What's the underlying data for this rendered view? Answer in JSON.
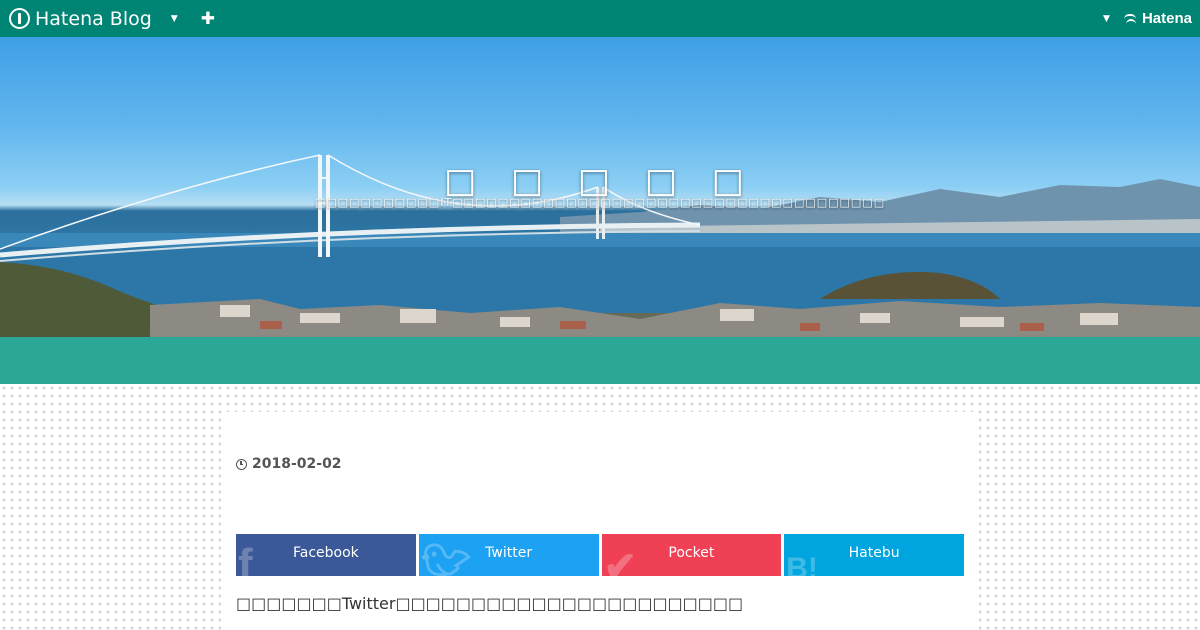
{
  "topbar": {
    "logo_text": "Hatena Blog",
    "brand_text": "Hatena",
    "bg_color": "#008574"
  },
  "hero": {
    "blog_title": "□ □ □ □ □",
    "blog_description": "□□□□□□□□□□□IT□□□□□□□□□□□□□□□□□□□□□□□□□□□□□□□□□□□□□□"
  },
  "band": {
    "color": "#2aa797"
  },
  "article": {
    "date": "2018-02-02",
    "lead_text": "□□□□□□□Twitter□□□□□□□□□□□□□□□□□□□□□□□"
  },
  "share": {
    "facebook_label": "Facebook",
    "twitter_label": "Twitter",
    "pocket_label": "Pocket",
    "hatebu_label": "Hatebu",
    "colors": {
      "facebook": "#3b5998",
      "twitter": "#1da1f2",
      "pocket": "#ef4056",
      "hatebu": "#00a4de"
    }
  }
}
